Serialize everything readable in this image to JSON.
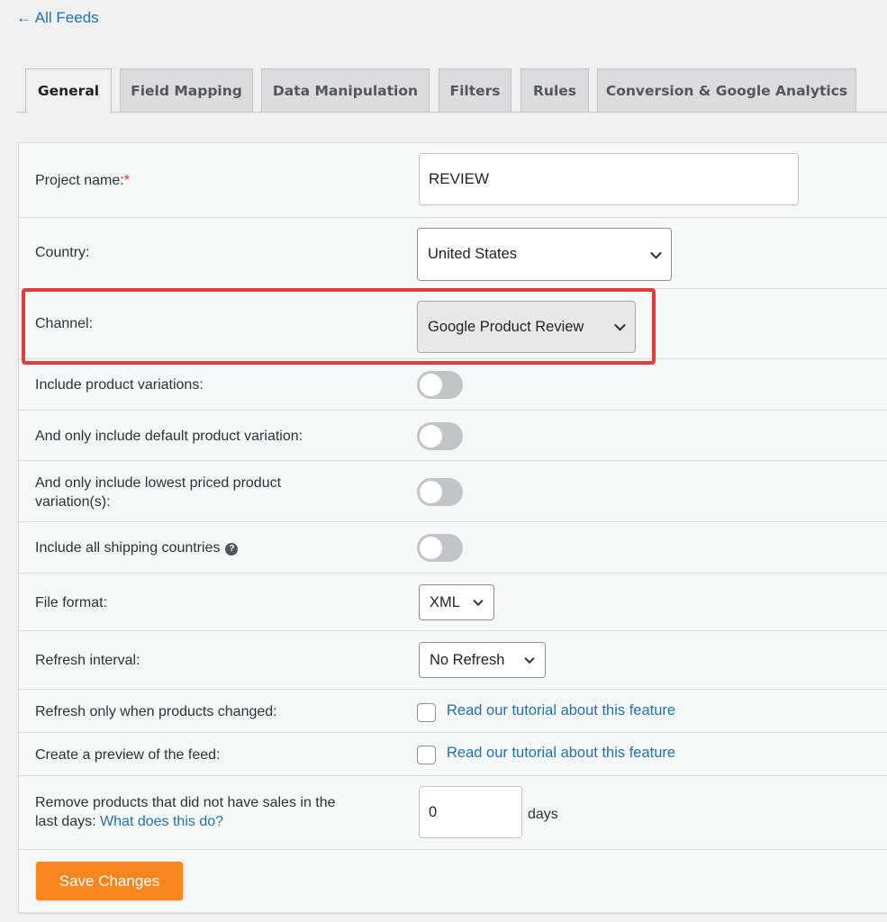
{
  "back_link": "← All Feeds",
  "tabs": [
    "General",
    "Field Mapping",
    "Data Manipulation",
    "Filters",
    "Rules",
    "Conversion & Google Analytics"
  ],
  "active_tab": "General",
  "form": {
    "project_name": {
      "label": "Project name:",
      "required_mark": "*",
      "value": "REVIEW"
    },
    "country": {
      "label": "Country:",
      "value": "United States"
    },
    "channel": {
      "label": "Channel:",
      "value": "Google Product Review",
      "disabled": true
    },
    "include_variations": {
      "label": "Include product variations:",
      "checked": false
    },
    "default_variation": {
      "label": "And only include default product variation:",
      "checked": false
    },
    "lowest_priced": {
      "label_line1": "And only include lowest priced product",
      "label_line2": "variation(s):",
      "checked": false
    },
    "all_shipping": {
      "label": "Include all shipping countries",
      "help_icon": "?",
      "checked": false
    },
    "file_format": {
      "label": "File format:",
      "value": "XML"
    },
    "refresh_interval": {
      "label": "Refresh interval:",
      "value": "No Refresh"
    },
    "refresh_changed": {
      "label": "Refresh only when products changed:",
      "checked": false,
      "link": "Read our tutorial about this feature"
    },
    "preview": {
      "label": "Create a preview of the feed:",
      "checked": false,
      "link": "Read our tutorial about this feature"
    },
    "remove_no_sales": {
      "label_line1": "Remove products that did not have sales in the",
      "label_line2": "last days:",
      "link": "What does this do?",
      "value": "0",
      "unit": "days"
    }
  },
  "save_button": "Save Changes",
  "colors": {
    "accent": "#f7861f",
    "link": "#2271b1",
    "highlight": "#e03c3c",
    "required": "#d63638"
  }
}
